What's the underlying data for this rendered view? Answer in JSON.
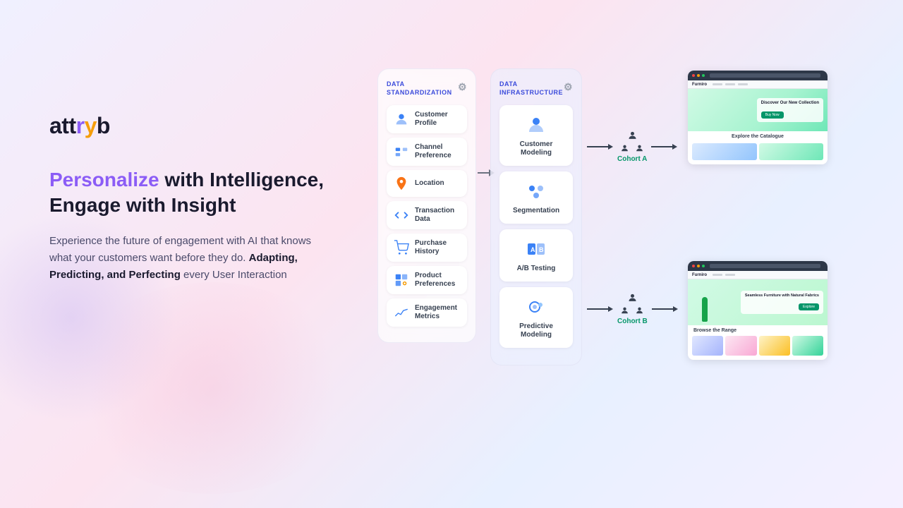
{
  "logo": {
    "text_att": "att",
    "text_r": "r",
    "text_y": "y",
    "text_b": "b"
  },
  "headline": {
    "personalize": "Personalize",
    "rest": " with Intelligence,\nEngage with Insight"
  },
  "description": {
    "intro": "Experience the future of engagement with AI that knows what your customers want before they do. ",
    "bold": "Adapting, Predicting, and Perfecting",
    "outro": " every User Interaction"
  },
  "columns": {
    "standardization": {
      "title": "DATA\nSTANDARDIZATION",
      "items": [
        {
          "label": "Customer\nProfile",
          "icon": "person"
        },
        {
          "label": "Channel\nPreference",
          "icon": "channel"
        },
        {
          "label": "Location",
          "icon": "location"
        },
        {
          "label": "Transaction\nData",
          "icon": "transaction"
        },
        {
          "label": "Purchase\nHistory",
          "icon": "purchase"
        },
        {
          "label": "Product\nPreferences",
          "icon": "product"
        },
        {
          "label": "Engagement\nMetrics",
          "icon": "engagement"
        }
      ]
    },
    "infrastructure": {
      "title": "DATA\nINFRASTRUCTURE",
      "items": [
        {
          "label": "Customer\nModeling",
          "icon": "modeling"
        },
        {
          "label": "Segmentation",
          "icon": "segmentation"
        },
        {
          "label": "A/B Testing",
          "icon": "ab"
        },
        {
          "label": "Predictive\nModeling",
          "icon": "predictive"
        }
      ]
    }
  },
  "cohorts": [
    {
      "name": "Cohort A"
    },
    {
      "name": "Cohort B"
    }
  ],
  "screenshots": [
    {
      "hero_text": "Discover Our\nNew Collection",
      "catalog_label": "Explore the Catalogue"
    },
    {
      "hero_text": "Seamless Furniture\nwith Natural Fabrics",
      "catalog_label": "Browse the Range"
    }
  ]
}
